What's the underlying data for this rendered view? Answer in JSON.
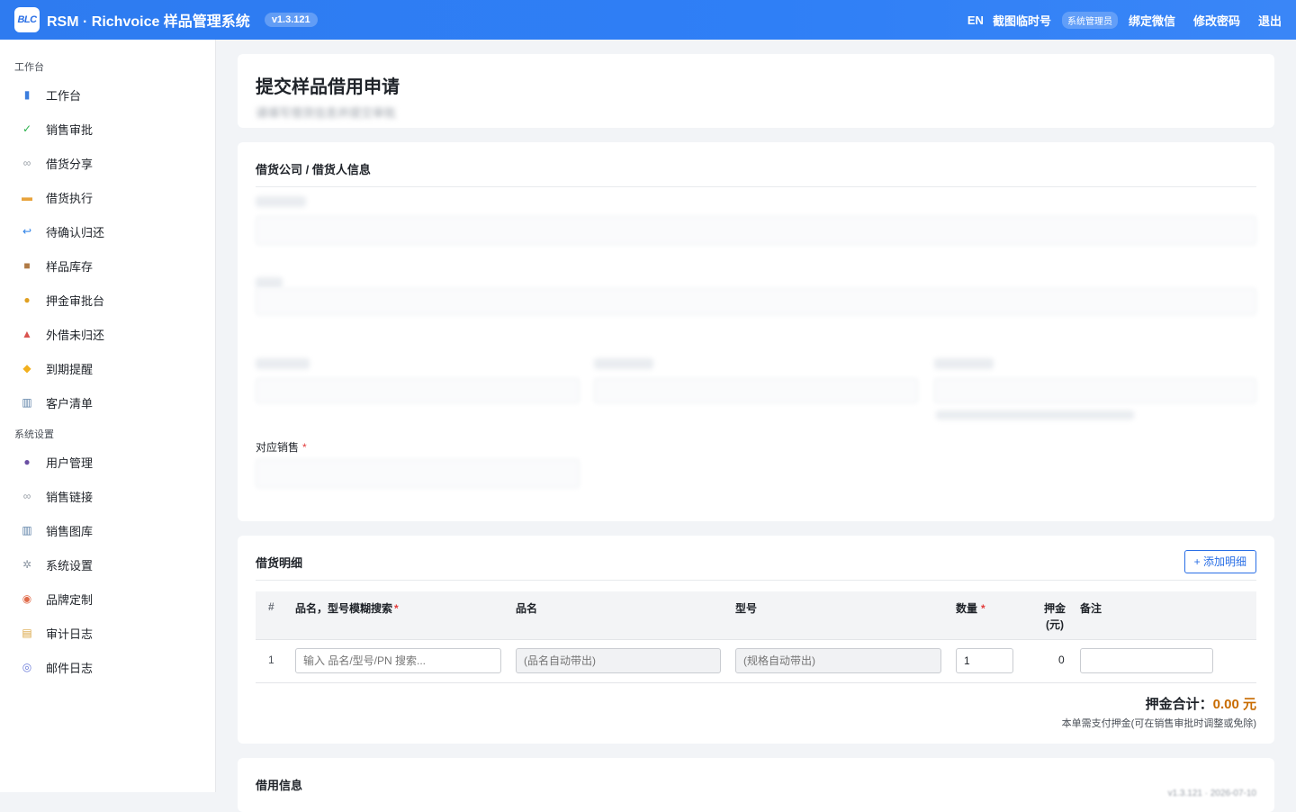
{
  "topbar": {
    "logo_text": "BLC",
    "app_title": "RSM · Richvoice 样品管理系统",
    "version": "v1.3.121",
    "nav": {
      "lang": "EN",
      "screenshot_id": "截图临时号",
      "role": "系统管理员",
      "bind_wechat": "绑定微信",
      "change_password": "修改密码",
      "logout": "退出"
    }
  },
  "sidebar": {
    "section_workbench": "工作台",
    "items_workbench": [
      {
        "label": "工作台",
        "icon": "chart-icon",
        "color": "#3b7ddd"
      },
      {
        "label": "销售审批",
        "icon": "check-icon",
        "color": "#2bb24c"
      },
      {
        "label": "借货分享",
        "icon": "link-icon",
        "color": "#9aa0a8"
      },
      {
        "label": "借货执行",
        "icon": "truck-icon",
        "color": "#e8a33b"
      },
      {
        "label": "待确认归还",
        "icon": "return-icon",
        "color": "#2a7fe6"
      },
      {
        "label": "样品库存",
        "icon": "box-icon",
        "color": "#b07a45"
      },
      {
        "label": "押金审批台",
        "icon": "money-bag-icon",
        "color": "#e0a020"
      },
      {
        "label": "外借未归还",
        "icon": "outbox-icon",
        "color": "#d9534f"
      },
      {
        "label": "到期提醒",
        "icon": "bell-icon",
        "color": "#f2b01e"
      },
      {
        "label": "客户清单",
        "icon": "building-icon",
        "color": "#5b7fa6"
      }
    ],
    "section_settings": "系统设置",
    "items_settings": [
      {
        "label": "用户管理",
        "icon": "users-icon",
        "color": "#6a4fa3"
      },
      {
        "label": "销售链接",
        "icon": "link-icon",
        "color": "#9aa0a8"
      },
      {
        "label": "销售图库",
        "icon": "building-icon",
        "color": "#5b7fa6"
      },
      {
        "label": "系统设置",
        "icon": "gear-icon",
        "color": "#8c96a3"
      },
      {
        "label": "品牌定制",
        "icon": "palette-icon",
        "color": "#e06b4a"
      },
      {
        "label": "审计日志",
        "icon": "scroll-icon",
        "color": "#d9a441"
      },
      {
        "label": "邮件日志",
        "icon": "mail-icon",
        "color": "#6b7cd9"
      }
    ]
  },
  "page": {
    "title": "提交样品借用申请",
    "subtitle_blurred": "请填写借货信息并提交审批"
  },
  "borrower_section": {
    "title": "借货公司 / 借货人信息",
    "sales_label": "对应销售",
    "required_mark": "*"
  },
  "detail_section": {
    "title": "借货明细",
    "add_button": "+ 添加明细",
    "columns": {
      "index": "#",
      "search": "品名，型号模糊搜索",
      "name": "品名",
      "model": "型号",
      "qty": "数量",
      "deposit_line1": "押金",
      "deposit_line2": "(元)",
      "remark": "备注"
    },
    "rows": [
      {
        "index": "1",
        "search_placeholder": "输入 品名/型号/PN 搜索...",
        "name_placeholder": "(品名自动带出)",
        "model_placeholder": "(规格自动带出)",
        "qty": "1",
        "deposit": "0",
        "remark": ""
      }
    ],
    "deposit_total_label": "押金合计：",
    "deposit_total_value": "0.00 元",
    "deposit_note": "本单需支付押金(可在销售审批时调整或免除)"
  },
  "borrow_info_section": {
    "title": "借用信息",
    "version_footer": "v1.3.121 · 2026-07-10"
  }
}
